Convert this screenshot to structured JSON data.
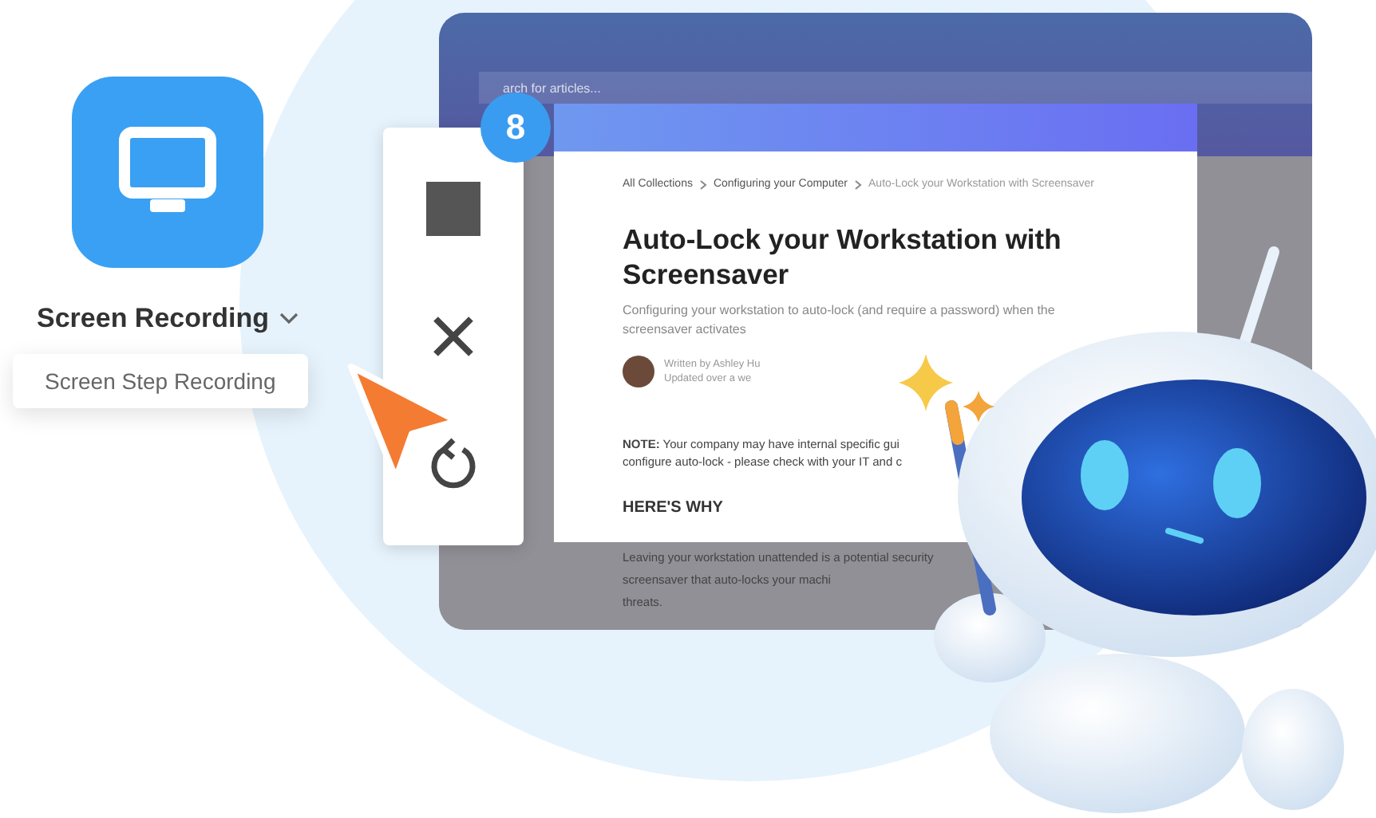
{
  "app_launcher": {
    "label": "Screen Recording",
    "menu_item": "Screen Step Recording"
  },
  "recorder_toolbar": {
    "step_count": "8"
  },
  "browser": {
    "search_placeholder": "arch for articles...",
    "breadcrumbs": [
      "All Collections",
      "Configuring your Computer",
      "Auto-Lock your Workstation with Screensaver"
    ],
    "title": "Auto-Lock your Workstation with Screensaver",
    "subtitle": "Configuring your workstation to auto-lock (and require a password) when the screensaver activates",
    "author": {
      "written_by": "Written by Ashley Hu",
      "updated": "Updated over a we"
    },
    "note_lines": [
      "**NOTE:** Your company may have internal specific gui",
      "configure auto-lock - please check with your IT and c"
    ],
    "section_heading": "HERE'S WHY",
    "body_lines": [
      "Leaving your workstation unattended is a potential security",
      "screensaver that auto-locks your machi",
      "threats."
    ]
  }
}
